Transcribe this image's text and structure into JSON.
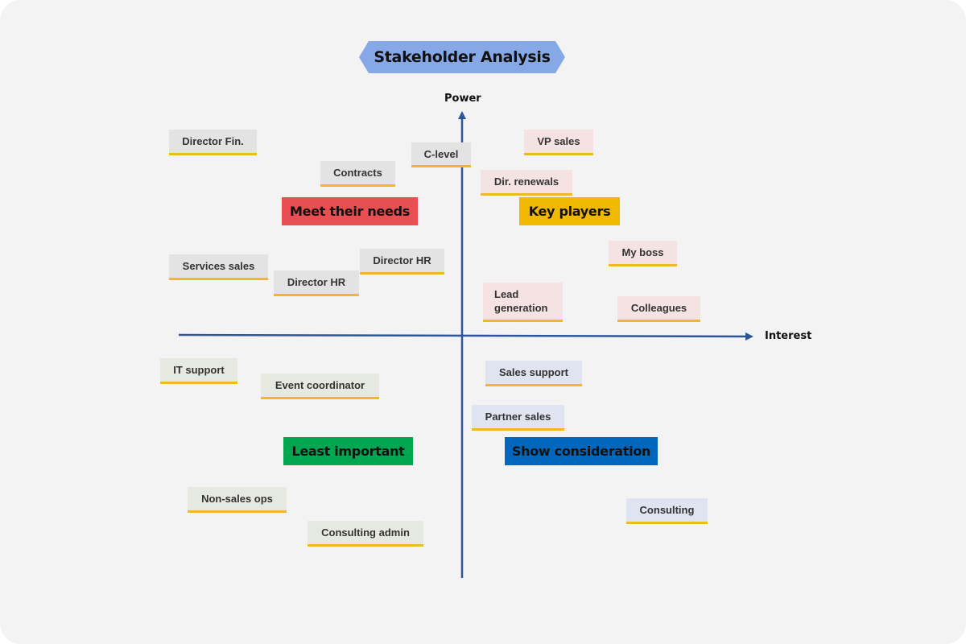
{
  "title": "Stakeholder Analysis",
  "axes": {
    "y_label": "Power",
    "x_label": "Interest",
    "color": "#2e5597"
  },
  "quadrants": {
    "top_left": {
      "label": "Meet their needs",
      "color": "#e84e52"
    },
    "top_right": {
      "label": "Key players",
      "color": "#f1b800"
    },
    "bottom_left": {
      "label": "Least important",
      "color": "#00a650"
    },
    "bottom_right": {
      "label": "Show consideration",
      "color": "#0067bd"
    }
  },
  "stakeholders": {
    "top_left": [
      "Director Fin.",
      "C-level",
      "Contracts",
      "Services sales",
      "Director HR",
      "Director HR"
    ],
    "top_right": [
      "VP sales",
      "Dir. renewals",
      "My boss",
      "Lead generation",
      "Colleagues"
    ],
    "bottom_left": [
      "IT support",
      "Event coordinator",
      "Non-sales ops",
      "Consulting admin"
    ],
    "bottom_right": [
      "Sales support",
      "Partner sales",
      "Consulting"
    ]
  },
  "note_underline_color": "#f0b823"
}
